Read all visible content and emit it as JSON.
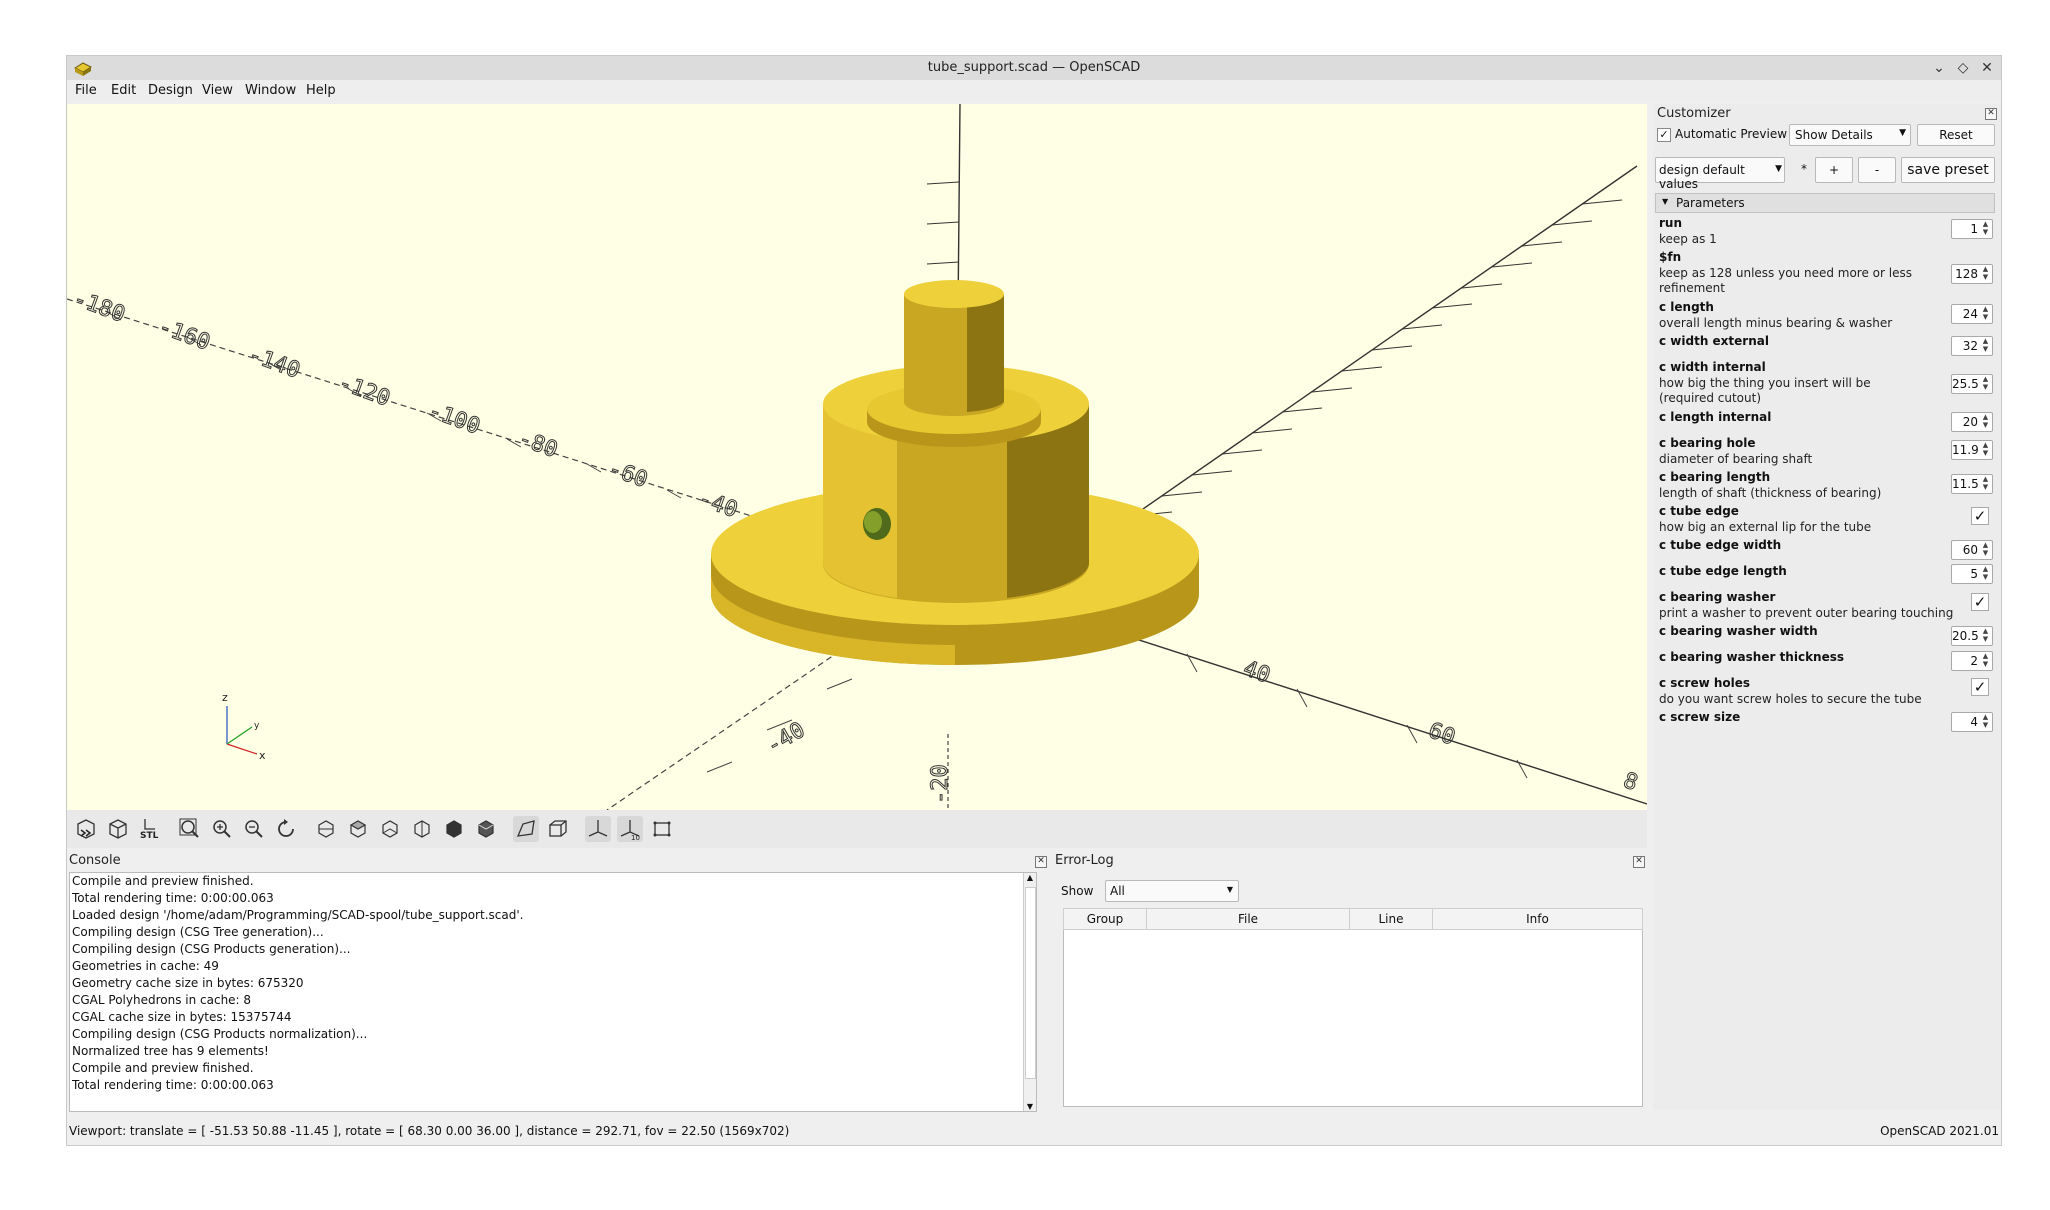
{
  "window": {
    "title": "tube_support.scad — OpenSCAD"
  },
  "menu": [
    "File",
    "Edit",
    "Design",
    "View",
    "Window",
    "Help"
  ],
  "viewport": {
    "axis_labels": {
      "x": "x",
      "y": "y",
      "z": "z"
    },
    "x_ticks_pos": [
      "40",
      "60",
      "8"
    ],
    "x_ticks_neg": [
      "-40",
      "-60",
      "-80",
      "-100",
      "-120",
      "-140",
      "-160",
      "-180"
    ],
    "y_ticks_neg": [
      "-20",
      "-40"
    ],
    "z_ticks": [
      "20"
    ]
  },
  "colors": {
    "model": "#e8c830",
    "viewport_bg": "#ffffe5",
    "window_bg": "#efefef"
  },
  "customizer": {
    "title": "Customizer",
    "auto_preview_label": "Automatic Preview",
    "auto_preview_checked": "✓",
    "details_select": "Show Details",
    "reset_label": "Reset",
    "preset_select": "design default values",
    "preset_modified": "*",
    "plus_label": "+",
    "minus_label": "-",
    "save_preset_label": "save preset",
    "section_title": "Parameters",
    "params": [
      {
        "name": "run",
        "desc": "keep as 1",
        "value": "1",
        "type": "number"
      },
      {
        "name": "$fn",
        "desc": "keep as 128 unless you need more or less refinement",
        "value": "128",
        "type": "number"
      },
      {
        "name": "c length",
        "desc": "overall length minus bearing & washer",
        "value": "24",
        "type": "number"
      },
      {
        "name": "c width external",
        "desc": "",
        "value": "32",
        "type": "number"
      },
      {
        "name": "c width internal",
        "desc": "how big the thing you insert will be (required cutout)",
        "value": "25.5",
        "type": "number"
      },
      {
        "name": "c length internal",
        "desc": "",
        "value": "20",
        "type": "number"
      },
      {
        "name": "c bearing hole",
        "desc": "diameter of bearing shaft",
        "value": "11.9",
        "type": "number"
      },
      {
        "name": "c bearing length",
        "desc": "length of shaft (thickness of bearing)",
        "value": "11.5",
        "type": "number"
      },
      {
        "name": "c tube edge",
        "desc": "how big an external lip for the tube",
        "value": "✓",
        "type": "check"
      },
      {
        "name": "c tube edge width",
        "desc": "",
        "value": "60",
        "type": "number"
      },
      {
        "name": "c tube edge length",
        "desc": "",
        "value": "5",
        "type": "number"
      },
      {
        "name": "c bearing washer",
        "desc": "print a washer to prevent outer bearing touching",
        "value": "✓",
        "type": "check"
      },
      {
        "name": "c bearing washer width",
        "desc": "",
        "value": "20.5",
        "type": "number"
      },
      {
        "name": "c bearing washer thickness",
        "desc": "",
        "value": "2",
        "type": "number"
      },
      {
        "name": "c screw holes",
        "desc": "do you want screw holes to secure the tube",
        "value": "✓",
        "type": "check"
      },
      {
        "name": "c screw size",
        "desc": "",
        "value": "4",
        "type": "number"
      }
    ]
  },
  "console": {
    "title": "Console",
    "lines": [
      "Compile and preview finished.",
      "Total rendering time: 0:00:00.063",
      "Loaded design '/home/adam/Programming/SCAD-spool/tube_support.scad'.",
      "Compiling design (CSG Tree generation)...",
      "Compiling design (CSG Products generation)...",
      "Geometries in cache: 49",
      "Geometry cache size in bytes: 675320",
      "CGAL Polyhedrons in cache: 8",
      "CGAL cache size in bytes: 15375744",
      "Compiling design (CSG Products normalization)...",
      "Normalized tree has 9 elements!",
      "Compile and preview finished.",
      "Total rendering time: 0:00:00.063"
    ]
  },
  "errorlog": {
    "title": "Error-Log",
    "show_label": "Show",
    "show_value": "All",
    "columns": [
      "Group",
      "File",
      "Line",
      "Info"
    ]
  },
  "status": {
    "left": "Viewport: translate = [ -51.53 50.88 -11.45 ], rotate = [ 68.30 0.00 36.00 ], distance = 292.71, fov = 22.50 (1569x702)",
    "right": "OpenSCAD 2021.01"
  }
}
